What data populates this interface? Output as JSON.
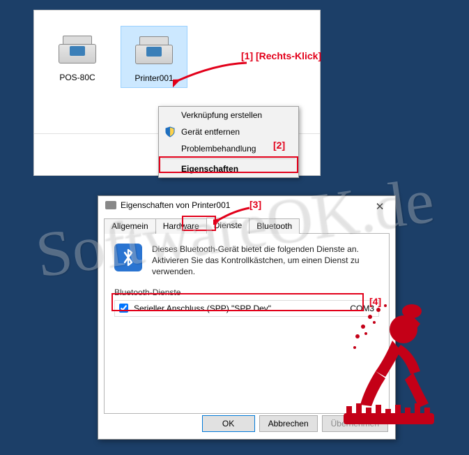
{
  "devicesPanel": {
    "devices": [
      {
        "label": "POS-80C"
      },
      {
        "label": "Printer001"
      }
    ]
  },
  "contextMenu": {
    "items": {
      "createShortcut": "Verknüpfung erstellen",
      "removeDevice": "Gerät entfernen",
      "troubleshoot": "Problembehandlung",
      "properties": "Eigenschaften"
    }
  },
  "annotations": {
    "step1": "[1] [Rechts-Klick]",
    "step2": "[2]",
    "step3": "[3]",
    "step4": "[4]"
  },
  "dialog": {
    "title": "Eigenschaften von Printer001",
    "closeGlyph": "✕",
    "tabs": {
      "general": "Allgemein",
      "hardware": "Hardware",
      "services": "Dienste",
      "bluetooth": "Bluetooth"
    },
    "btGlyph": "∗",
    "description": "Dieses Bluetooth-Gerät bietet die folgenden Dienste an. Aktivieren Sie das Kontrollkästchen, um einen Dienst zu verwenden.",
    "groupLabel": "Bluetooth-Dienste",
    "service": {
      "label": "Serieller Anschluss (SPP) \"SPP Dev\"",
      "port": "COM3"
    },
    "buttons": {
      "ok": "OK",
      "cancel": "Abbrechen",
      "apply": "Übernehmen"
    }
  },
  "watermark": "SoftwareOK.de"
}
